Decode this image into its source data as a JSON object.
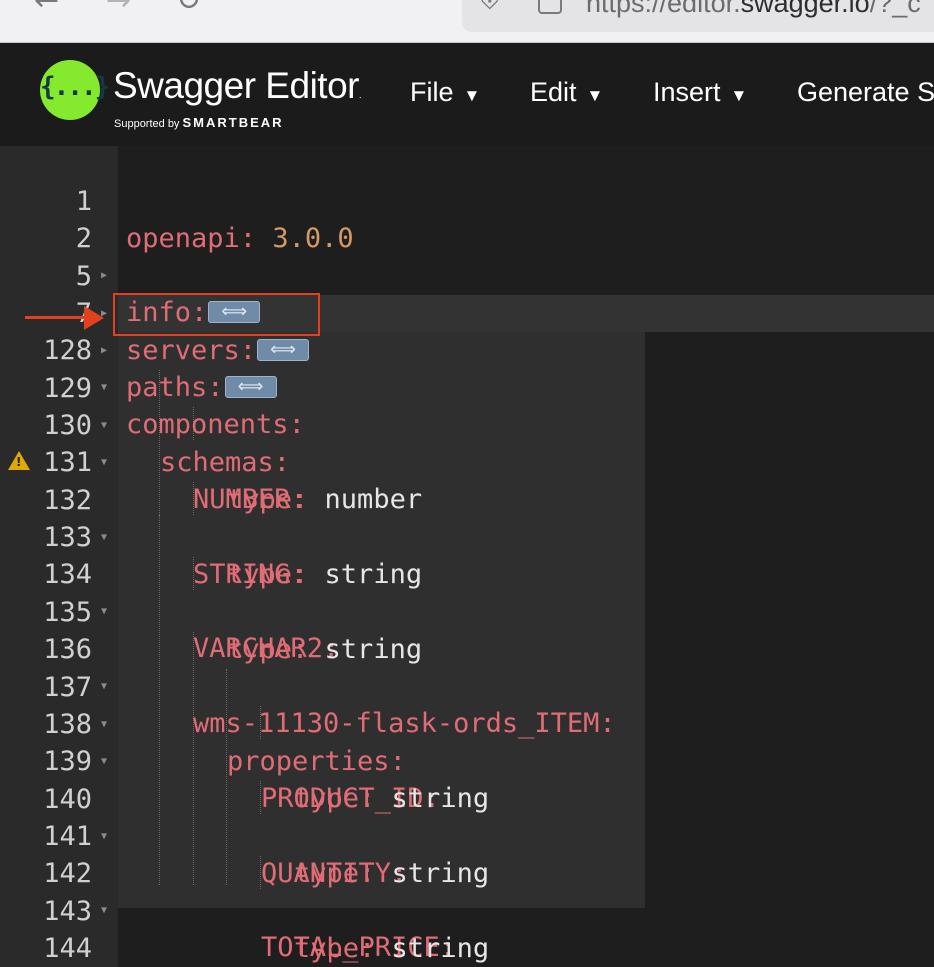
{
  "browser": {
    "url_prefix": "https://editor.",
    "url_domain": "swagger.io",
    "url_suffix": "/?_c",
    "back_icon": "←",
    "forward_icon": "→",
    "reload_icon": "↻"
  },
  "topbar": {
    "brand": "Swagger Editor",
    "brand_mark": ".",
    "supported_by": "Supported by",
    "company": "SMARTBEAR",
    "logo_glyph": "{...}",
    "logo_color": "#85ea2d",
    "menu": [
      {
        "label": "File",
        "caret": "▼"
      },
      {
        "label": "Edit",
        "caret": "▼"
      },
      {
        "label": "Insert",
        "caret": "▼"
      },
      {
        "label": "Generate S"
      }
    ]
  },
  "editor": {
    "lines": [
      {
        "num": "1",
        "key": "openapi",
        "colon": ": ",
        "value": "3.0.0"
      },
      {
        "num": "2",
        "key": "info",
        "colon": ":"
      },
      {
        "num": "5",
        "key": "servers",
        "colon": ":"
      },
      {
        "num": "7",
        "key": "paths",
        "colon": ":"
      },
      {
        "num": "128",
        "key": "components",
        "colon": ":"
      },
      {
        "num": "129",
        "key": "schemas",
        "colon": ":"
      },
      {
        "num": "130",
        "key": "NUMBER",
        "colon": ":"
      },
      {
        "num": "131",
        "key": "type",
        "colon": ": ",
        "value": "number"
      },
      {
        "num": "132",
        "key": "STRING",
        "colon": ":"
      },
      {
        "num": "133",
        "key": "type",
        "colon": ": ",
        "value": "string"
      },
      {
        "num": "134",
        "key": "VARCHAR2",
        "colon": ":"
      },
      {
        "num": "135",
        "key": "type",
        "colon": ": ",
        "value": "string"
      },
      {
        "num": "136",
        "key": "wms-11130-flask-ords_ITEM",
        "colon": ":"
      },
      {
        "num": "137",
        "key": "properties",
        "colon": ":"
      },
      {
        "num": "138",
        "key": "PRODUCT_ID",
        "colon": ":"
      },
      {
        "num": "139",
        "key": "type",
        "colon": ": ",
        "value": "string"
      },
      {
        "num": "140",
        "key": "QUANTITY",
        "colon": ":"
      },
      {
        "num": "141",
        "key": "type",
        "colon": ": ",
        "value": "string"
      },
      {
        "num": "142",
        "key": "TOTAL_PRICE",
        "colon": ":"
      },
      {
        "num": "143",
        "key": "type",
        "colon": ": ",
        "value": "string"
      },
      {
        "num": "144"
      }
    ],
    "warning_icon": "!",
    "fold_marker": "▼",
    "annotation_color": "#e2401f"
  }
}
